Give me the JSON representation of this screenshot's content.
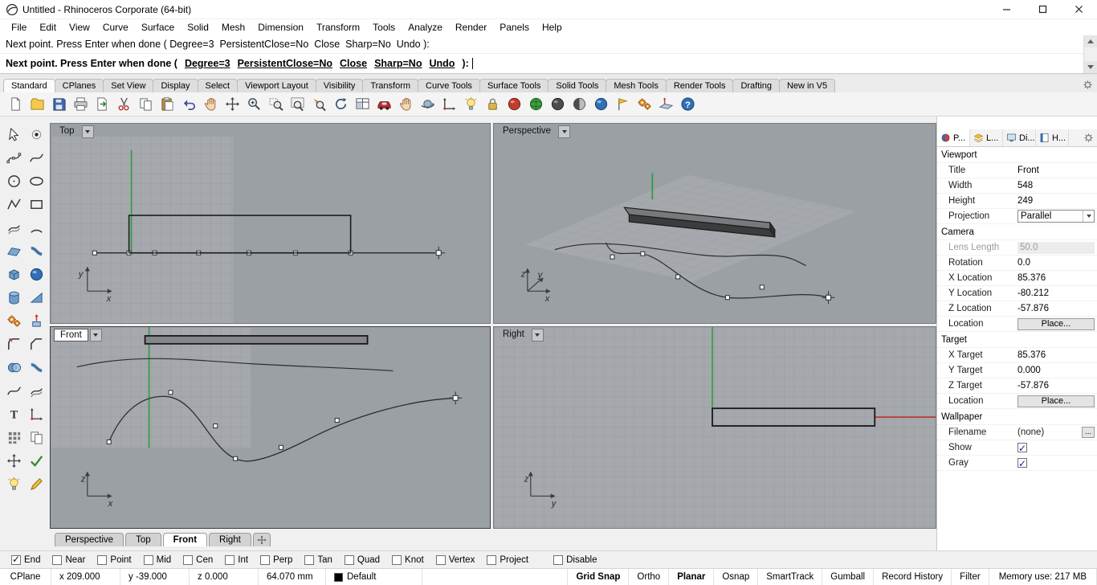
{
  "window": {
    "title": "Untitled - Rhinoceros Corporate (64-bit)"
  },
  "menu": {
    "items": [
      {
        "name": "menu-file",
        "label": "File"
      },
      {
        "name": "menu-edit",
        "label": "Edit"
      },
      {
        "name": "menu-view",
        "label": "View"
      },
      {
        "name": "menu-curve",
        "label": "Curve"
      },
      {
        "name": "menu-surface",
        "label": "Surface"
      },
      {
        "name": "menu-solid",
        "label": "Solid"
      },
      {
        "name": "menu-mesh",
        "label": "Mesh"
      },
      {
        "name": "menu-dimension",
        "label": "Dimension"
      },
      {
        "name": "menu-transform",
        "label": "Transform"
      },
      {
        "name": "menu-tools",
        "label": "Tools"
      },
      {
        "name": "menu-analyze",
        "label": "Analyze"
      },
      {
        "name": "menu-render",
        "label": "Render"
      },
      {
        "name": "menu-panels",
        "label": "Panels"
      },
      {
        "name": "menu-help",
        "label": "Help"
      }
    ]
  },
  "cmd": {
    "history": "Next point. Press Enter when done ( Degree=3  PersistentClose=No  Close  Sharp=No  Undo ):",
    "prompt_prefix": "Next point. Press Enter when done (",
    "options": [
      {
        "name": "cmd-option-degree",
        "label": "Degree=3"
      },
      {
        "name": "cmd-option-persistentclose",
        "label": "PersistentClose=No"
      },
      {
        "name": "cmd-option-close",
        "label": "Close"
      },
      {
        "name": "cmd-option-sharp",
        "label": "Sharp=No"
      },
      {
        "name": "cmd-option-undo",
        "label": "Undo"
      }
    ],
    "prompt_suffix": "):"
  },
  "toolbar_tabs": {
    "items": [
      {
        "name": "toolbar-tab-standard",
        "label": "Standard",
        "active": true
      },
      {
        "name": "toolbar-tab-cplanes",
        "label": "CPlanes"
      },
      {
        "name": "toolbar-tab-set-view",
        "label": "Set View"
      },
      {
        "name": "toolbar-tab-display",
        "label": "Display"
      },
      {
        "name": "toolbar-tab-select",
        "label": "Select"
      },
      {
        "name": "toolbar-tab-viewport-layout",
        "label": "Viewport Layout"
      },
      {
        "name": "toolbar-tab-visibility",
        "label": "Visibility"
      },
      {
        "name": "toolbar-tab-transform",
        "label": "Transform"
      },
      {
        "name": "toolbar-tab-curve-tools",
        "label": "Curve Tools"
      },
      {
        "name": "toolbar-tab-surface-tools",
        "label": "Surface Tools"
      },
      {
        "name": "toolbar-tab-solid-tools",
        "label": "Solid Tools"
      },
      {
        "name": "toolbar-tab-mesh-tools",
        "label": "Mesh Tools"
      },
      {
        "name": "toolbar-tab-render-tools",
        "label": "Render Tools"
      },
      {
        "name": "toolbar-tab-drafting",
        "label": "Drafting"
      },
      {
        "name": "toolbar-tab-new-in-v5",
        "label": "New in V5"
      }
    ]
  },
  "toolbar_icons": {
    "items": [
      {
        "name": "new-file-icon",
        "sym": "sym-page"
      },
      {
        "name": "open-file-icon",
        "sym": "sym-folder"
      },
      {
        "name": "save-icon",
        "sym": "sym-save"
      },
      {
        "name": "print-icon",
        "sym": "sym-print"
      },
      {
        "name": "export-icon",
        "sym": "sym-export"
      },
      {
        "name": "cut-icon",
        "sym": "sym-cut"
      },
      {
        "name": "copy-icon",
        "sym": "sym-copy"
      },
      {
        "name": "paste-icon",
        "sym": "sym-paste"
      },
      {
        "name": "undo-icon",
        "sym": "sym-undo"
      },
      {
        "name": "pan-icon",
        "sym": "sym-hand"
      },
      {
        "name": "move-icon",
        "sym": "sym-move"
      },
      {
        "name": "zoom-dynamic-icon",
        "sym": "sym-zoom"
      },
      {
        "name": "zoom-window-icon",
        "sym": "sym-zoomwin"
      },
      {
        "name": "zoom-extents-icon",
        "sym": "sym-zoomext"
      },
      {
        "name": "zoom-selected-icon",
        "sym": "sym-zoomsel"
      },
      {
        "name": "undo-view-change-icon",
        "sym": "sym-rotview"
      },
      {
        "name": "viewport-layout-icon",
        "sym": "sym-table"
      },
      {
        "name": "named-view-icon",
        "sym": "sym-car"
      },
      {
        "name": "pan-view-icon",
        "sym": "sym-hand"
      },
      {
        "name": "rotate-view-icon",
        "sym": "sym-orbit"
      },
      {
        "name": "cplane-icon",
        "sym": "sym-axes"
      },
      {
        "name": "lamp-icon",
        "sym": "sym-bulb"
      },
      {
        "name": "lock-icon",
        "sym": "sym-lock"
      },
      {
        "name": "render-icon",
        "sym": "sym-globe-red"
      },
      {
        "name": "render-preview-icon",
        "sym": "sym-globe-green"
      },
      {
        "name": "shaded-viewport-icon",
        "sym": "sym-sphere-dark"
      },
      {
        "name": "ghosted-viewport-icon",
        "sym": "sym-sphere-half"
      },
      {
        "name": "rendered-viewport-icon",
        "sym": "sym-sphere-blue"
      },
      {
        "name": "what-command-icon",
        "sym": "sym-flag"
      },
      {
        "name": "options-icon",
        "sym": "sym-gears"
      },
      {
        "name": "set-cplane-icon",
        "sym": "sym-cplane"
      },
      {
        "name": "help-icon",
        "sym": "sym-help"
      }
    ]
  },
  "sidebar": {
    "items": [
      {
        "name": "select-arrow-icon",
        "sym": "sym-cursor"
      },
      {
        "name": "point-icon",
        "sym": "sym-point"
      },
      {
        "name": "control-point-curve-icon",
        "sym": "sym-curvepts"
      },
      {
        "name": "interpolate-curve-icon",
        "sym": "sym-curve"
      },
      {
        "name": "circle-icon",
        "sym": "sym-circle"
      },
      {
        "name": "ellipse-icon",
        "sym": "sym-ellipse"
      },
      {
        "name": "polyline-icon",
        "sym": "sym-polyline"
      },
      {
        "name": "rectangle-icon",
        "sym": "sym-rectshape"
      },
      {
        "name": "offset-curve-icon",
        "sym": "sym-offset"
      },
      {
        "name": "arc-icon",
        "sym": "sym-arc"
      },
      {
        "name": "surface-icon",
        "sym": "sym-surface"
      },
      {
        "name": "sweep-icon",
        "sym": "sym-pipe"
      },
      {
        "name": "box-icon",
        "sym": "sym-box"
      },
      {
        "name": "sphere-icon",
        "sym": "sym-sphere-blue"
      },
      {
        "name": "cylinder-icon",
        "sym": "sym-cylinder"
      },
      {
        "name": "cone-icon",
        "sym": "sym-wedge"
      },
      {
        "name": "mesh-icon",
        "sym": "sym-gears"
      },
      {
        "name": "extrude-icon",
        "sym": "sym-extrude"
      },
      {
        "name": "fillet-icon",
        "sym": "sym-fillet"
      },
      {
        "name": "chamfer-icon",
        "sym": "sym-chamfer"
      },
      {
        "name": "boolean-icon",
        "sym": "sym-boolean"
      },
      {
        "name": "pipe-icon",
        "sym": "sym-pipe"
      },
      {
        "name": "curve-from-object-icon",
        "sym": "sym-curve"
      },
      {
        "name": "project-icon",
        "sym": "sym-offset"
      },
      {
        "name": "text-icon",
        "sym": "sym-text"
      },
      {
        "name": "orient-icon",
        "sym": "sym-axes"
      },
      {
        "name": "array-icon",
        "sym": "sym-array"
      },
      {
        "name": "group-icon",
        "sym": "sym-copy"
      },
      {
        "name": "gumball-icon",
        "sym": "sym-move"
      },
      {
        "name": "check-icon",
        "sym": "sym-check"
      },
      {
        "name": "hide-icon",
        "sym": "sym-bulb"
      },
      {
        "name": "annotate-icon",
        "sym": "sym-pencil"
      }
    ]
  },
  "viewports": {
    "top": "Top",
    "perspective": "Perspective",
    "front": "Front",
    "right": "Right"
  },
  "axes": {
    "x": "x",
    "y": "y",
    "z": "z"
  },
  "vtabs": {
    "items": [
      {
        "name": "viewport-tab-perspective",
        "label": "Perspective"
      },
      {
        "name": "viewport-tab-top",
        "label": "Top"
      },
      {
        "name": "viewport-tab-front",
        "label": "Front",
        "active": true
      },
      {
        "name": "viewport-tab-right",
        "label": "Right"
      }
    ]
  },
  "panel": {
    "tabs": [
      {
        "name": "panel-tab-properties",
        "icon": "properties-tab-icon",
        "sym": "sym-tab-props",
        "label": "P...",
        "active": true
      },
      {
        "name": "panel-tab-layers",
        "icon": "layers-tab-icon",
        "sym": "sym-tab-layers",
        "label": "L..."
      },
      {
        "name": "panel-tab-display",
        "icon": "display-tab-icon",
        "sym": "sym-tab-display",
        "label": "Di..."
      },
      {
        "name": "panel-tab-help",
        "icon": "help-tab-icon",
        "sym": "sym-tab-help",
        "label": "H..."
      }
    ]
  },
  "props": {
    "sec_viewport": "Viewport",
    "title_l": "Title",
    "title_v": "Front",
    "width_l": "Width",
    "width_v": "548",
    "height_l": "Height",
    "height_v": "249",
    "proj_l": "Projection",
    "proj_v": "Parallel",
    "sec_camera": "Camera",
    "lens_l": "Lens Length",
    "lens_v": "50.0",
    "rot_l": "Rotation",
    "rot_v": "0.0",
    "xloc_l": "X Location",
    "xloc_v": "85.376",
    "yloc_l": "Y Location",
    "yloc_v": "-80.212",
    "zloc_l": "Z Location",
    "zloc_v": "-57.876",
    "loc_l": "Location",
    "loc_btn": "Place...",
    "sec_target": "Target",
    "xtar_l": "X Target",
    "xtar_v": "85.376",
    "ytar_l": "Y Target",
    "ytar_v": "0.000",
    "ztar_l": "Z Target",
    "ztar_v": "-57.876",
    "tloc_l": "Location",
    "tloc_btn": "Place...",
    "sec_wall": "Wallpaper",
    "file_l": "Filename",
    "file_v": "(none)",
    "file_btn": "...",
    "show_l": "Show",
    "gray_l": "Gray"
  },
  "osnap": {
    "items": [
      {
        "name": "osnap-end",
        "label": "End",
        "checked": true
      },
      {
        "name": "osnap-near",
        "label": "Near"
      },
      {
        "name": "osnap-point",
        "label": "Point"
      },
      {
        "name": "osnap-mid",
        "label": "Mid"
      },
      {
        "name": "osnap-cen",
        "label": "Cen"
      },
      {
        "name": "osnap-int",
        "label": "Int"
      },
      {
        "name": "osnap-perp",
        "label": "Perp"
      },
      {
        "name": "osnap-tan",
        "label": "Tan"
      },
      {
        "name": "osnap-quad",
        "label": "Quad"
      },
      {
        "name": "osnap-knot",
        "label": "Knot"
      },
      {
        "name": "osnap-vertex",
        "label": "Vertex"
      },
      {
        "name": "osnap-project",
        "label": "Project"
      },
      {
        "name": "osnap-disable",
        "label": "Disable",
        "gap": true
      }
    ]
  },
  "status": {
    "items": [
      {
        "name": "cplane-pane",
        "label": "CPlane",
        "cls": "c-cplane",
        "interactable": true
      },
      {
        "name": "x-coordinate",
        "label": "x 209.000",
        "cls": "c-x"
      },
      {
        "name": "y-coordinate",
        "label": "y -39.000",
        "cls": "c-y"
      },
      {
        "name": "z-coordinate",
        "label": "z 0.000",
        "cls": "c-z"
      },
      {
        "name": "distance-readout",
        "label": "64.070 mm",
        "cls": "c-units"
      },
      {
        "name": "layer-pane",
        "label": "Default",
        "cls": "c-layer",
        "swatch": true,
        "interactable": true
      },
      {
        "name": "status-spacer",
        "label": "",
        "cls": "c-spacer"
      },
      {
        "name": "grid-snap-pane",
        "label": "Grid Snap",
        "bold": true,
        "interactable": true
      },
      {
        "name": "ortho-pane",
        "label": "Ortho",
        "interactable": true
      },
      {
        "name": "planar-pane",
        "label": "Planar",
        "bold": true,
        "interactable": true
      },
      {
        "name": "osnap-pane",
        "label": "Osnap",
        "interactable": true
      },
      {
        "name": "smarttrack-pane",
        "label": "SmartTrack",
        "interactable": true
      },
      {
        "name": "gumball-pane",
        "label": "Gumball",
        "interactable": true
      },
      {
        "name": "record-history-pane",
        "label": "Record History",
        "interactable": true
      },
      {
        "name": "filter-pane",
        "label": "Filter",
        "interactable": true
      },
      {
        "name": "memory-pane",
        "label": "Memory use: 217 MB",
        "cls": "c-mem"
      }
    ]
  }
}
